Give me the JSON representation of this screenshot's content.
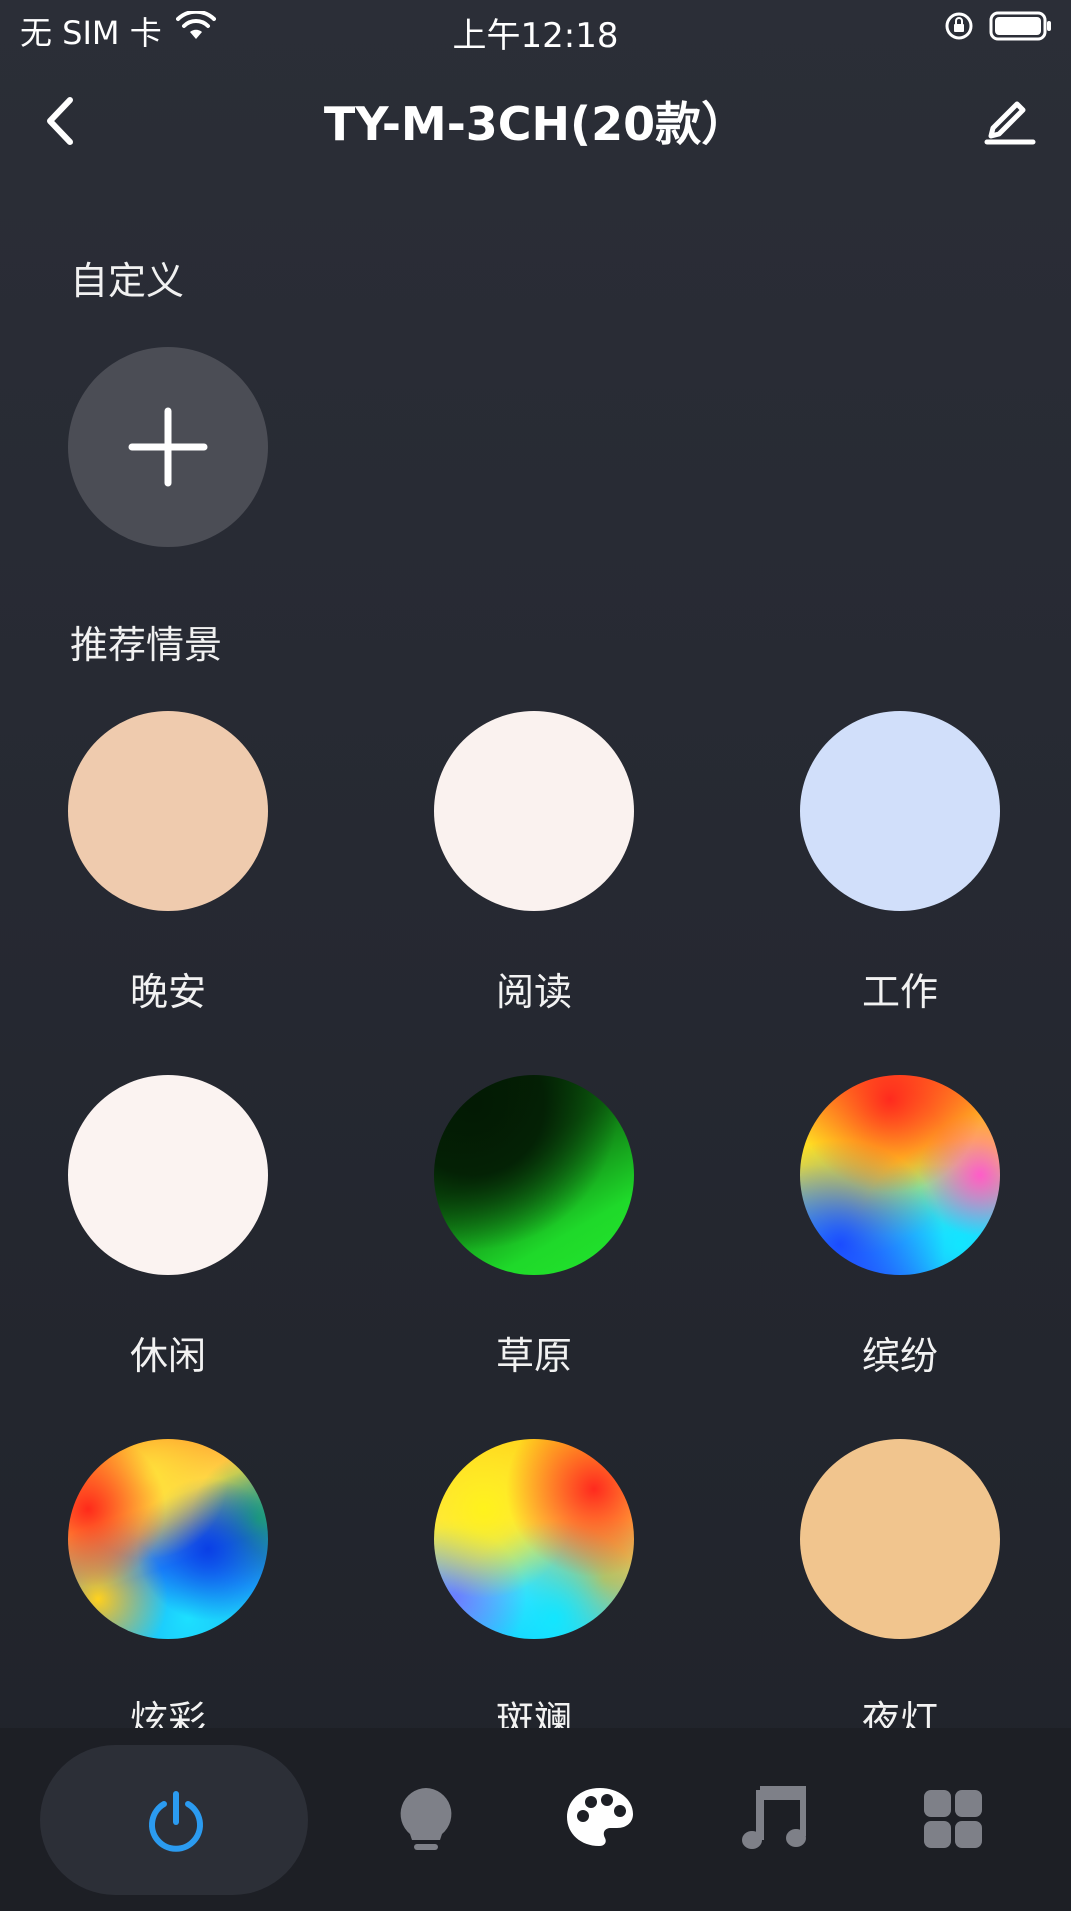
{
  "status_bar": {
    "carrier": "无 SIM 卡",
    "time": "上午12:18"
  },
  "header": {
    "title": "TY-M-3CH(20款）"
  },
  "custom_section": {
    "title": "自定义"
  },
  "recommended_section": {
    "title": "推荐情景",
    "scenes": [
      {
        "label": "晚安",
        "color": "#efcbae"
      },
      {
        "label": "阅读",
        "color": "#faf2ef"
      },
      {
        "label": "工作",
        "color": "#d1dffa"
      },
      {
        "label": "休闲",
        "color": "#fbf3f1"
      },
      {
        "label": "草原",
        "color": "#1fd92a"
      },
      {
        "label": "缤纷",
        "color": "#multi"
      },
      {
        "label": "炫彩",
        "color": "#multi"
      },
      {
        "label": "斑斓",
        "color": "#multi"
      },
      {
        "label": "夜灯",
        "color": "#f1c58e"
      }
    ]
  },
  "tab_bar": {
    "tabs": [
      {
        "icon": "power-icon",
        "active": true,
        "color": "#2b9bf0"
      },
      {
        "icon": "bulb-icon",
        "active": false
      },
      {
        "icon": "palette-icon",
        "active": true
      },
      {
        "icon": "music-icon",
        "active": false
      },
      {
        "icon": "grid-icon",
        "active": false
      }
    ]
  }
}
